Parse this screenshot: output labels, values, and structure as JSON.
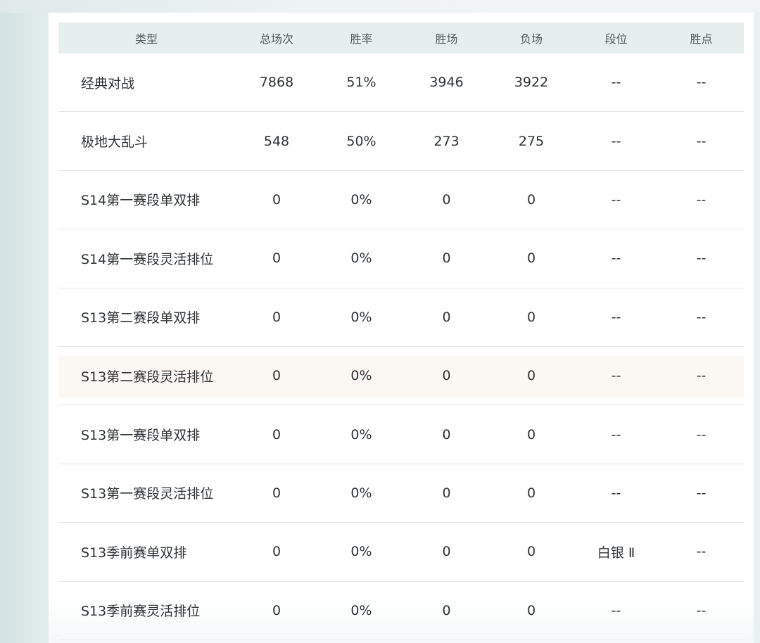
{
  "table": {
    "headers": {
      "type": "类型",
      "total": "总场次",
      "win_rate": "胜率",
      "wins": "胜场",
      "losses": "负场",
      "rank": "段位",
      "points": "胜点"
    },
    "rows": [
      {
        "type": "经典对战",
        "total": "7868",
        "win_rate": "51%",
        "wins": "3946",
        "losses": "3922",
        "rank": "--",
        "points": "--"
      },
      {
        "type": "极地大乱斗",
        "total": "548",
        "win_rate": "50%",
        "wins": "273",
        "losses": "275",
        "rank": "--",
        "points": "--"
      },
      {
        "type": "S14第一赛段单双排",
        "total": "0",
        "win_rate": "0%",
        "wins": "0",
        "losses": "0",
        "rank": "--",
        "points": "--"
      },
      {
        "type": "S14第一赛段灵活排位",
        "total": "0",
        "win_rate": "0%",
        "wins": "0",
        "losses": "0",
        "rank": "--",
        "points": "--"
      },
      {
        "type": "S13第二赛段单双排",
        "total": "0",
        "win_rate": "0%",
        "wins": "0",
        "losses": "0",
        "rank": "--",
        "points": "--"
      },
      {
        "type": "S13第二赛段灵活排位",
        "total": "0",
        "win_rate": "0%",
        "wins": "0",
        "losses": "0",
        "rank": "--",
        "points": "--"
      },
      {
        "type": "S13第一赛段单双排",
        "total": "0",
        "win_rate": "0%",
        "wins": "0",
        "losses": "0",
        "rank": "--",
        "points": "--"
      },
      {
        "type": "S13第一赛段灵活排位",
        "total": "0",
        "win_rate": "0%",
        "wins": "0",
        "losses": "0",
        "rank": "--",
        "points": "--"
      },
      {
        "type": "S13季前赛单双排",
        "total": "0",
        "win_rate": "0%",
        "wins": "0",
        "losses": "0",
        "rank": "白银 Ⅱ",
        "points": "--"
      },
      {
        "type": "S13季前赛灵活排位",
        "total": "0",
        "win_rate": "0%",
        "wins": "0",
        "losses": "0",
        "rank": "--",
        "points": "--"
      }
    ]
  },
  "colors": {
    "header_bg": "#e6efed",
    "highlight_row_bg": "#fbf7f3",
    "text": "#2f3336",
    "header_text": "#55595c"
  }
}
